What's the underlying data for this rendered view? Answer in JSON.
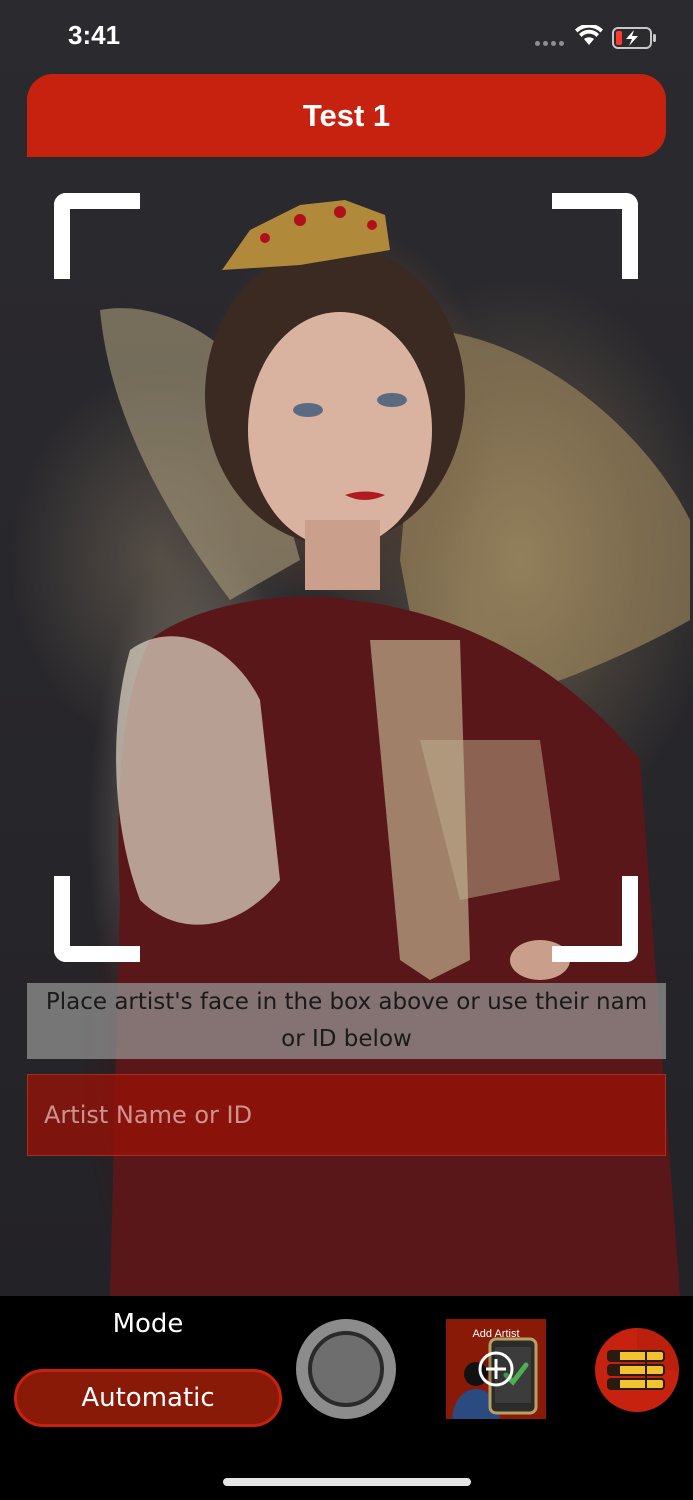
{
  "status_bar": {
    "time": "3:41"
  },
  "header": {
    "title": "Test 1"
  },
  "instruction": {
    "text": "Place artist's face in the box above or use their nam or ID below"
  },
  "artist_input": {
    "placeholder": "Artist Name or ID",
    "value": ""
  },
  "mode": {
    "label": "Mode",
    "selected": "Automatic"
  },
  "add_artist": {
    "label": "Add Artist"
  },
  "colors": {
    "accent": "#c6220f",
    "accent_dark": "#8a1a08",
    "bottom_bar": "#000000"
  },
  "icons": {
    "shutter": "camera-shutter-icon",
    "add_artist": "add-artist-icon",
    "list": "list-menu-icon",
    "wifi": "wifi-icon",
    "battery": "battery-charging-icon"
  }
}
